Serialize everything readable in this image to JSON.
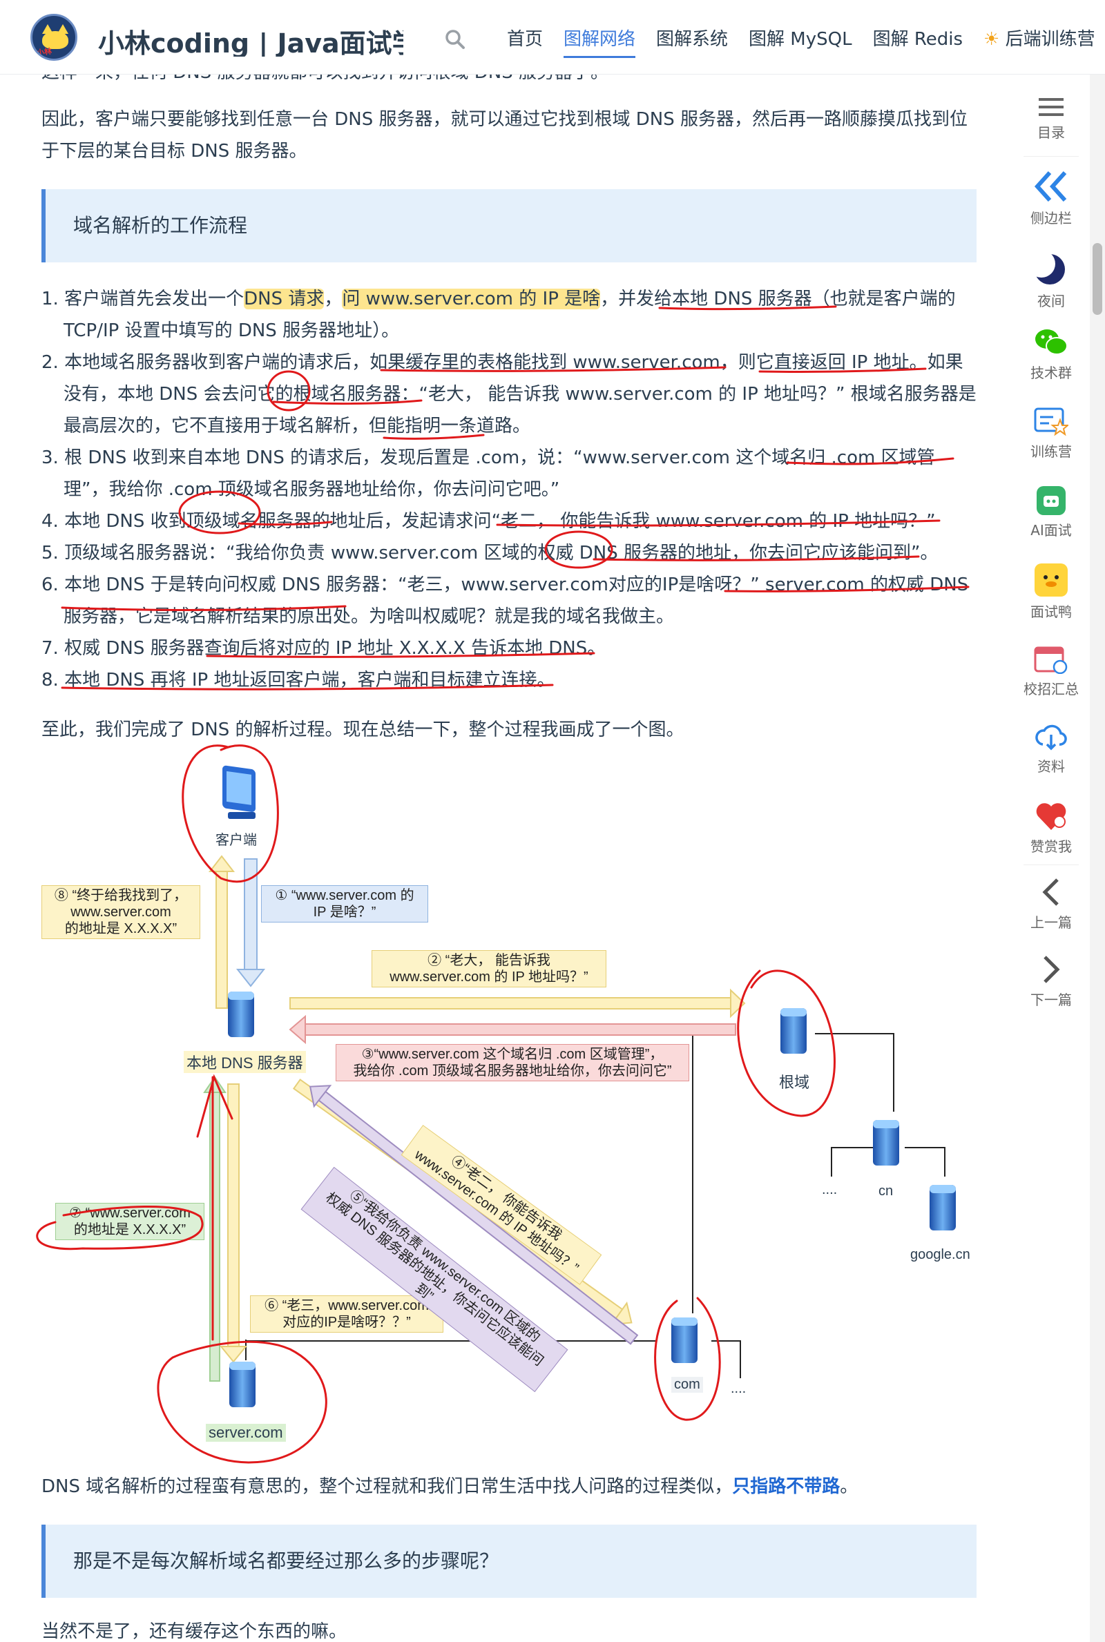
{
  "nav": {
    "site_title": "小林coding | Java面试学习",
    "logo_text": "小林",
    "items": [
      "首页",
      "图解网络",
      "图解系统",
      "图解 MySQL",
      "图解 Redis",
      "后端训练营"
    ],
    "active": "图解网络"
  },
  "content": {
    "cut_line": "这样一来，任何 DNS 服务器就都可以找到并访问根域 DNS 服务器了。",
    "intro": "因此，客户端只要能够找到任意一台 DNS 服务器，就可以通过它找到根域 DNS 服务器，然后再一路顺藤摸瓜找到位于下层的某台目标 DNS 服务器。",
    "section_title": "域名解析的工作流程",
    "steps": [
      {
        "num": "1.",
        "pre": "客户端首先会发出一个",
        "hl1": "DNS 请求",
        "mid": "，",
        "hl2": "问 www.server.com 的 IP 是啥",
        "post": "，并发给本地 DNS 服务器（也就是客户端的 TCP/IP 设置中填写的 DNS 服务器地址）。"
      },
      {
        "num": "2.",
        "text": "本地域名服务器收到客户端的请求后，如果缓存里的表格能找到 www.server.com，则它直接返回 IP 地址。如果没有，本地 DNS 会去问它的根域名服务器：“老大， 能告诉我 www.server.com 的 IP 地址吗？” 根域名服务器是最高层次的，它不直接用于域名解析，但能指明一条道路。"
      },
      {
        "num": "3.",
        "text": "根 DNS 收到来自本地 DNS 的请求后，发现后置是 .com，说：“www.server.com 这个域名归 .com 区域管理”，我给你 .com 顶级域名服务器地址给你，你去问问它吧。”"
      },
      {
        "num": "4.",
        "text": "本地 DNS 收到顶级域名服务器的地址后，发起请求问“老二， 你能告诉我 www.server.com 的 IP 地址吗？”"
      },
      {
        "num": "5.",
        "text": "顶级域名服务器说：“我给你负责 www.server.com 区域的权威 DNS 服务器的地址，你去问它应该能问到”。"
      },
      {
        "num": "6.",
        "text": "本地 DNS 于是转向问权威 DNS 服务器：“老三，www.server.com对应的IP是啥呀？” server.com 的权威 DNS 服务器，它是域名解析结果的原出处。为啥叫权威呢？就是我的域名我做主。"
      },
      {
        "num": "7.",
        "text": "权威 DNS 服务器查询后将对应的 IP 地址 X.X.X.X 告诉本地 DNS。"
      },
      {
        "num": "8.",
        "text": "本地 DNS 再将 IP 地址返回客户端，客户端和目标建立连接。"
      }
    ],
    "summary": "至此，我们完成了 DNS 的解析过程。现在总结一下，整个过程我画成了一个图。",
    "after_pre": "DNS 域名解析的过程蛮有意思的，整个过程就和我们日常生活中找人问路的过程类似，",
    "after_bold": "只指路不带路",
    "after_post": "。",
    "section2_title": "那是不是每次解析域名都要经过那么多的步骤呢？",
    "tail": "当然不是了，还有缓存这个东西的嘛。"
  },
  "diagram": {
    "client": "客户端",
    "local_dns": "本地 DNS 服务器",
    "root": "根域",
    "com": "com",
    "cn": "cn",
    "google": "google.cn",
    "server": "server.com",
    "dots1": "....",
    "dots2": "....",
    "note1": "① “www.server.com 的\nIP 是啥？”",
    "note2": "② “老大， 能告诉我\nwww.server.com 的 IP 地址吗？”",
    "note3": "③“www.server.com 这个域名归 .com 区域管理”，\n我给你 .com 顶级域名服务器地址给你，你去问问它”",
    "note4": "④“老二， 你能告诉我\nwww.server.com 的 IP 地址吗？”",
    "note5": "⑤“我给你负责 www.server.com 区域的\n权威 DNS 服务器的地址，你去问它应该能问到”",
    "note6": "⑥ “老三，www.server.com\n对应的IP是啥呀？？”",
    "note7": "⑦ “www.server.com\n的地址是 X.X.X.X”",
    "note8": "⑧ “终于给我找到了，\nwww.server.com\n的地址是 X.X.X.X”"
  },
  "sidebar": {
    "items": [
      "目录",
      "侧边栏",
      "夜间",
      "技术群",
      "训练营",
      "AI面试",
      "面试鸭",
      "校招汇总",
      "资料",
      "赞赏我",
      "上一篇",
      "下一篇"
    ]
  },
  "colors": {
    "accent": "#3e7bdb",
    "highlight": "#fde58f",
    "ink": "#e0191b"
  }
}
